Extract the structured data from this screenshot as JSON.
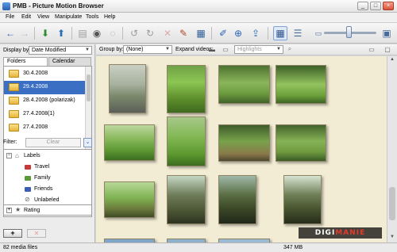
{
  "window": {
    "title": "PMB - Picture Motion Browser"
  },
  "menu": [
    "File",
    "Edit",
    "View",
    "Manipulate",
    "Tools",
    "Help"
  ],
  "left_panel": {
    "display_by_label": "Display by:",
    "display_by_value": "Date Modified",
    "tabs": [
      "Folders",
      "Calendar"
    ],
    "folders": [
      {
        "label": "30.4.2008",
        "selected": false
      },
      {
        "label": "29.4.2008",
        "selected": true
      },
      {
        "label": "28.4.2008 (polarizak)",
        "selected": false
      },
      {
        "label": "27.4.2008(1)",
        "selected": false
      },
      {
        "label": "27.4.2008",
        "selected": false
      }
    ],
    "filter_label": "Filter:",
    "clear_label": "Clear",
    "labels_group": "Labels",
    "labels": [
      {
        "label": "Travel",
        "color": "#c63a3a"
      },
      {
        "label": "Family",
        "color": "#5a9a38"
      },
      {
        "label": "Friends",
        "color": "#3c5fb5"
      },
      {
        "label": "Unlabeled",
        "color": "#7a7a7a"
      }
    ],
    "rating_label": "Rating"
  },
  "right_toolbar": {
    "group_by_label": "Group by:",
    "group_by_value": "(None)",
    "expand_videos_label": "Expand videos:",
    "highlights_value": "Highlights"
  },
  "status": {
    "left": "82 media files",
    "right": "347 MB"
  },
  "watermark": {
    "part1": "DIGI",
    "part2": "MANIE"
  },
  "icons": {
    "toolbar": [
      "back-icon",
      "forward-icon",
      "import-icon",
      "export-icon",
      "burn-disc-icon",
      "globe-icon",
      "print-icon",
      "rotate-left-icon",
      "rotate-right-icon",
      "delete-icon",
      "tools-icon",
      "slideshow-icon",
      "edit-pencil-icon",
      "map-icon",
      "share-icon",
      "thumbnail-view-icon",
      "list-view-icon",
      "zoom-out-icon",
      "zoom-in-icon"
    ]
  }
}
